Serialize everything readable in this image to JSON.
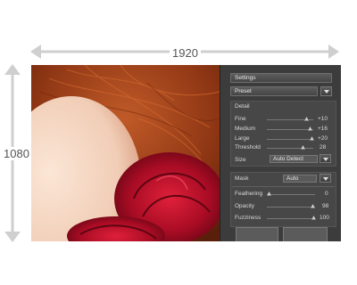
{
  "annotations": {
    "width": "1920",
    "height": "1080"
  },
  "panel": {
    "title": "Settings",
    "preset": "Preset",
    "detail_header": "Detail",
    "sliders": [
      {
        "label": "Fine",
        "value": "+10"
      },
      {
        "label": "Medium",
        "value": "+16"
      },
      {
        "label": "Large",
        "value": "+20"
      },
      {
        "label": "Threshold",
        "value": "28"
      }
    ],
    "size": {
      "label": "Size",
      "value": "Auto Detect"
    },
    "mask": {
      "label": "Mask",
      "value": "Auto"
    },
    "mask_sliders": [
      {
        "label": "Feathering",
        "value": "0"
      },
      {
        "label": "Opacity",
        "value": "98"
      },
      {
        "label": "Fuzziness",
        "value": "100"
      }
    ]
  },
  "colors": {
    "panel_bg": "#3c3c3c",
    "photo_hair": "#a3441a",
    "rose": "#b0102a"
  }
}
